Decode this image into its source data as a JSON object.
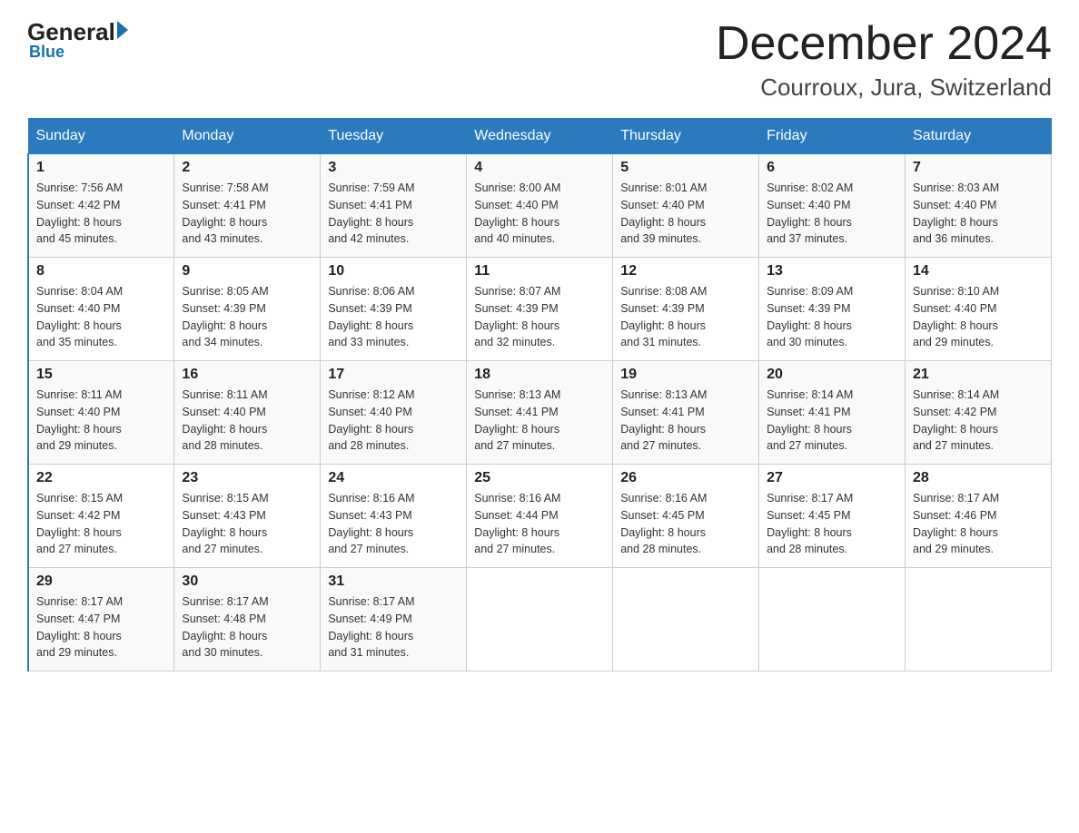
{
  "logo": {
    "general": "General",
    "blue": "Blue"
  },
  "title": {
    "month": "December 2024",
    "location": "Courroux, Jura, Switzerland"
  },
  "days_header": [
    "Sunday",
    "Monday",
    "Tuesday",
    "Wednesday",
    "Thursday",
    "Friday",
    "Saturday"
  ],
  "weeks": [
    [
      {
        "day": "1",
        "sunrise": "7:56 AM",
        "sunset": "4:42 PM",
        "daylight": "8 hours and 45 minutes."
      },
      {
        "day": "2",
        "sunrise": "7:58 AM",
        "sunset": "4:41 PM",
        "daylight": "8 hours and 43 minutes."
      },
      {
        "day": "3",
        "sunrise": "7:59 AM",
        "sunset": "4:41 PM",
        "daylight": "8 hours and 42 minutes."
      },
      {
        "day": "4",
        "sunrise": "8:00 AM",
        "sunset": "4:40 PM",
        "daylight": "8 hours and 40 minutes."
      },
      {
        "day": "5",
        "sunrise": "8:01 AM",
        "sunset": "4:40 PM",
        "daylight": "8 hours and 39 minutes."
      },
      {
        "day": "6",
        "sunrise": "8:02 AM",
        "sunset": "4:40 PM",
        "daylight": "8 hours and 37 minutes."
      },
      {
        "day": "7",
        "sunrise": "8:03 AM",
        "sunset": "4:40 PM",
        "daylight": "8 hours and 36 minutes."
      }
    ],
    [
      {
        "day": "8",
        "sunrise": "8:04 AM",
        "sunset": "4:40 PM",
        "daylight": "8 hours and 35 minutes."
      },
      {
        "day": "9",
        "sunrise": "8:05 AM",
        "sunset": "4:39 PM",
        "daylight": "8 hours and 34 minutes."
      },
      {
        "day": "10",
        "sunrise": "8:06 AM",
        "sunset": "4:39 PM",
        "daylight": "8 hours and 33 minutes."
      },
      {
        "day": "11",
        "sunrise": "8:07 AM",
        "sunset": "4:39 PM",
        "daylight": "8 hours and 32 minutes."
      },
      {
        "day": "12",
        "sunrise": "8:08 AM",
        "sunset": "4:39 PM",
        "daylight": "8 hours and 31 minutes."
      },
      {
        "day": "13",
        "sunrise": "8:09 AM",
        "sunset": "4:39 PM",
        "daylight": "8 hours and 30 minutes."
      },
      {
        "day": "14",
        "sunrise": "8:10 AM",
        "sunset": "4:40 PM",
        "daylight": "8 hours and 29 minutes."
      }
    ],
    [
      {
        "day": "15",
        "sunrise": "8:11 AM",
        "sunset": "4:40 PM",
        "daylight": "8 hours and 29 minutes."
      },
      {
        "day": "16",
        "sunrise": "8:11 AM",
        "sunset": "4:40 PM",
        "daylight": "8 hours and 28 minutes."
      },
      {
        "day": "17",
        "sunrise": "8:12 AM",
        "sunset": "4:40 PM",
        "daylight": "8 hours and 28 minutes."
      },
      {
        "day": "18",
        "sunrise": "8:13 AM",
        "sunset": "4:41 PM",
        "daylight": "8 hours and 27 minutes."
      },
      {
        "day": "19",
        "sunrise": "8:13 AM",
        "sunset": "4:41 PM",
        "daylight": "8 hours and 27 minutes."
      },
      {
        "day": "20",
        "sunrise": "8:14 AM",
        "sunset": "4:41 PM",
        "daylight": "8 hours and 27 minutes."
      },
      {
        "day": "21",
        "sunrise": "8:14 AM",
        "sunset": "4:42 PM",
        "daylight": "8 hours and 27 minutes."
      }
    ],
    [
      {
        "day": "22",
        "sunrise": "8:15 AM",
        "sunset": "4:42 PM",
        "daylight": "8 hours and 27 minutes."
      },
      {
        "day": "23",
        "sunrise": "8:15 AM",
        "sunset": "4:43 PM",
        "daylight": "8 hours and 27 minutes."
      },
      {
        "day": "24",
        "sunrise": "8:16 AM",
        "sunset": "4:43 PM",
        "daylight": "8 hours and 27 minutes."
      },
      {
        "day": "25",
        "sunrise": "8:16 AM",
        "sunset": "4:44 PM",
        "daylight": "8 hours and 27 minutes."
      },
      {
        "day": "26",
        "sunrise": "8:16 AM",
        "sunset": "4:45 PM",
        "daylight": "8 hours and 28 minutes."
      },
      {
        "day": "27",
        "sunrise": "8:17 AM",
        "sunset": "4:45 PM",
        "daylight": "8 hours and 28 minutes."
      },
      {
        "day": "28",
        "sunrise": "8:17 AM",
        "sunset": "4:46 PM",
        "daylight": "8 hours and 29 minutes."
      }
    ],
    [
      {
        "day": "29",
        "sunrise": "8:17 AM",
        "sunset": "4:47 PM",
        "daylight": "8 hours and 29 minutes."
      },
      {
        "day": "30",
        "sunrise": "8:17 AM",
        "sunset": "4:48 PM",
        "daylight": "8 hours and 30 minutes."
      },
      {
        "day": "31",
        "sunrise": "8:17 AM",
        "sunset": "4:49 PM",
        "daylight": "8 hours and 31 minutes."
      },
      null,
      null,
      null,
      null
    ]
  ],
  "labels": {
    "sunrise": "Sunrise:",
    "sunset": "Sunset:",
    "daylight": "Daylight:"
  }
}
